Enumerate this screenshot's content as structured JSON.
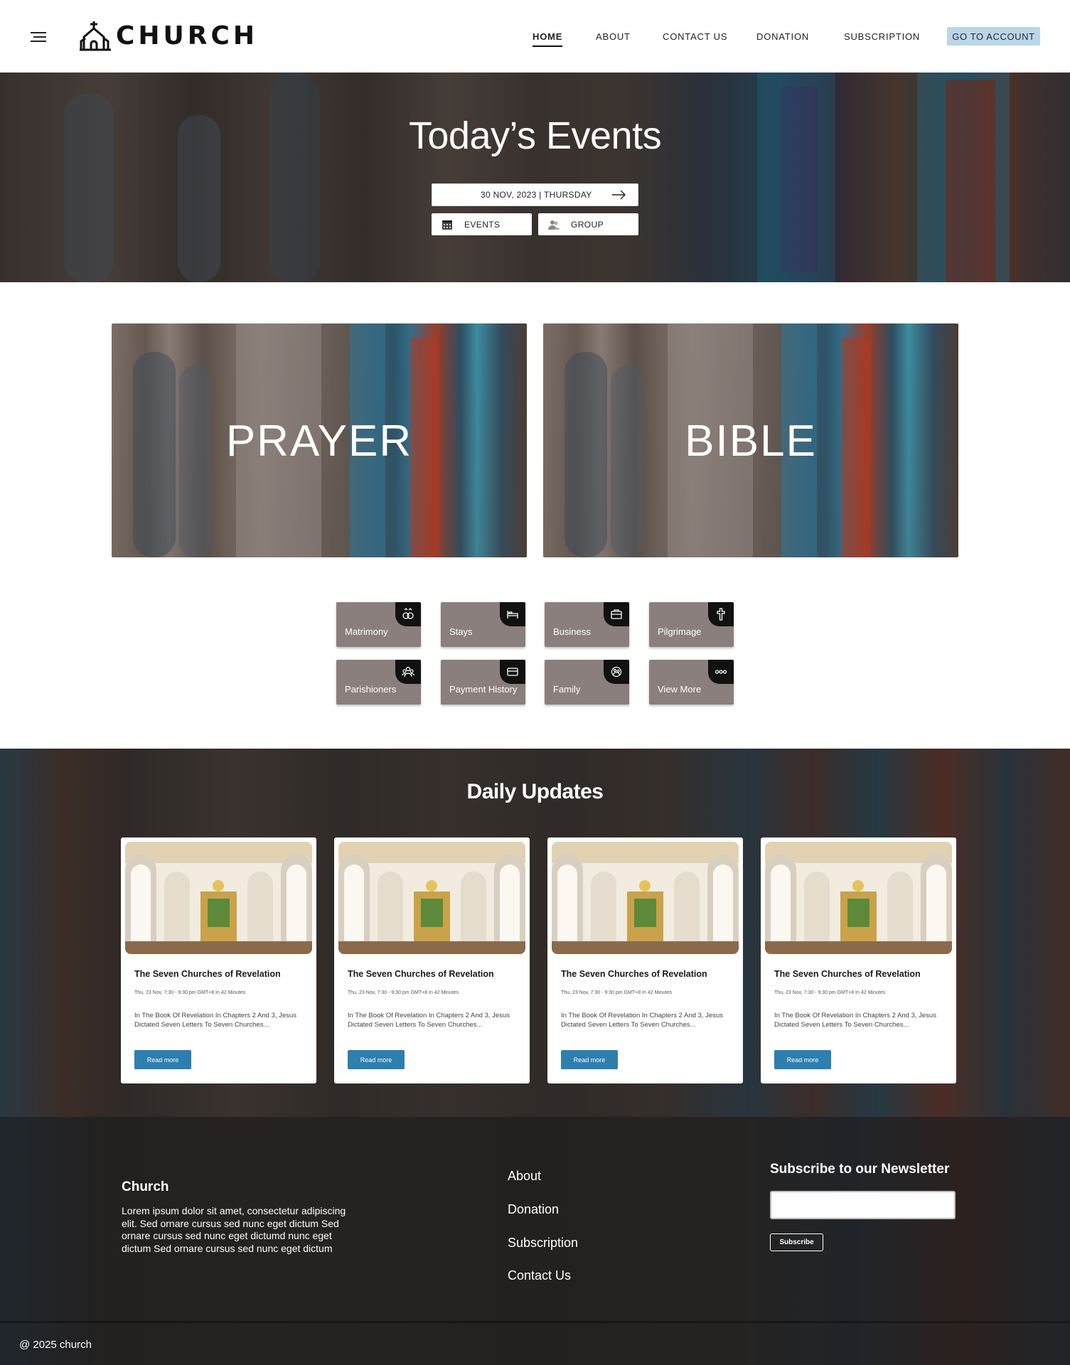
{
  "header": {
    "logo_text": "CHURCH",
    "nav": [
      {
        "label": "HOME",
        "active": true
      },
      {
        "label": "ABOUT",
        "active": false
      },
      {
        "label": "CONTACT US",
        "active": false
      },
      {
        "label": "DONATION",
        "active": false
      },
      {
        "label": "SUBSCRIPTION",
        "active": false
      }
    ],
    "account_label": "GO TO ACCOUNT",
    "account_color": "#bcd6e8"
  },
  "hero": {
    "title": "Today’s Events",
    "date": "30 NOV, 2023 | THURSDAY",
    "events_label": "EVENTS",
    "group_label": "GROUP"
  },
  "features": {
    "prayer": "PRAYER",
    "bible": "BIBLE"
  },
  "tiles": [
    {
      "label": "Matrimony",
      "icon": "rings-icon"
    },
    {
      "label": "Stays",
      "icon": "bed-icon"
    },
    {
      "label": "Business",
      "icon": "briefcase-icon"
    },
    {
      "label": "Pilgrimage",
      "icon": "cross-icon"
    },
    {
      "label": "Parishioners",
      "icon": "people-icon"
    },
    {
      "label": "Payment History",
      "icon": "card-icon"
    },
    {
      "label": "Family",
      "icon": "family-icon"
    },
    {
      "label": "View More",
      "icon": "more-icon"
    }
  ],
  "updates": {
    "title": "Daily Updates",
    "cards": [
      {
        "title": "The Seven Churches of Revelation",
        "meta": "Thu, 23 Nov, 7:30 - 9:30 pm GMT+8 In 42 Minutes",
        "desc": "In The Book Of Revelation In Chapters 2 And 3, Jesus Dictated Seven Letters To Seven Churches...",
        "button": "Read more"
      },
      {
        "title": "The Seven Churches of Revelation",
        "meta": "Thu, 23 Nov, 7:30 - 9:30 pm GMT+8 In 42 Minutes",
        "desc": "In The Book Of Revelation In Chapters 2 And 3, Jesus Dictated Seven Letters To Seven Churches...",
        "button": "Read more"
      },
      {
        "title": "The Seven Churches of Revelation",
        "meta": "Thu, 23 Nov, 7:30 - 9:30 pm GMT+8 In 42 Minutes",
        "desc": "In The Book Of Revelation In Chapters 2 And 3, Jesus Dictated Seven Letters To Seven Churches...",
        "button": "Read more"
      },
      {
        "title": "The Seven Churches of Revelation",
        "meta": "Thu, 23 Nov, 7:30 - 9:30 pm GMT+8 In 42 Minutes",
        "desc": "In The Book Of Revelation In Chapters 2 And 3, Jesus Dictated Seven Letters To Seven Churches...",
        "button": "Read more"
      }
    ],
    "button_color": "#2d7fb0"
  },
  "footer": {
    "title": "Church",
    "description": "Lorem ipsum dolor sit amet, consectetur adipiscing elit. Sed ornare cursus sed nunc eget dictum  Sed ornare cursus sed nunc eget dictumd nunc eget dictum  Sed ornare cursus sed nunc eget dictum",
    "links": [
      "About",
      "Donation",
      "Subscription",
      "Contact Us"
    ],
    "newsletter_title": "Subscribe to our Newsletter",
    "newsletter_value": "",
    "subscribe_label": "Subscribe",
    "copyright": "@ 2025 church"
  }
}
